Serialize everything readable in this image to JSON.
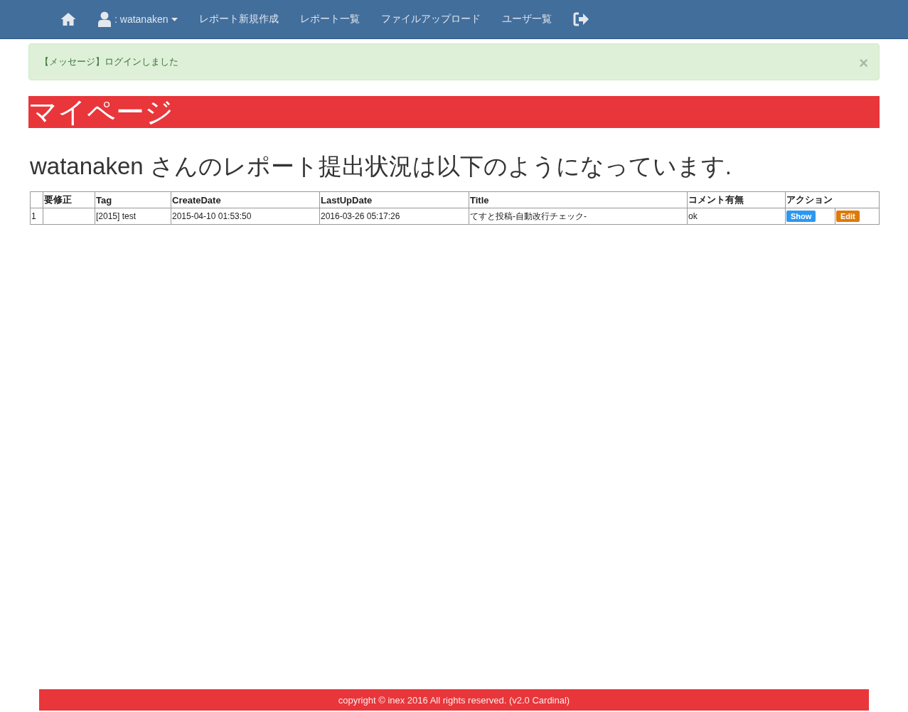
{
  "navbar": {
    "user": ": watanaken",
    "links": [
      "レポート新規作成",
      "レポート一覧",
      "ファイルアップロード",
      "ユーザ一覧"
    ]
  },
  "alert": {
    "message": "【メッセージ】ログインしました",
    "close": "×"
  },
  "page_title": "マイページ",
  "heading": "watanaken さんのレポート提出状況は以下のようになっています.",
  "table": {
    "columns": [
      "要修正",
      "Tag",
      "CreateDate",
      "LastUpDate",
      "Title",
      "コメント有無",
      "アクション"
    ],
    "rows": [
      {
        "number": "1",
        "tag": "[2015] test",
        "create_date": "2015-04-10 01:53:50",
        "last_update": "2016-03-26 05:17:26",
        "title": "てすと投稿-自動改行チェック-",
        "comment": "ok",
        "actions": [
          "Show",
          "Edit"
        ]
      }
    ]
  },
  "footer": "copyright © inex 2016 All rights reserved. (v2.0 Cardinal)"
}
